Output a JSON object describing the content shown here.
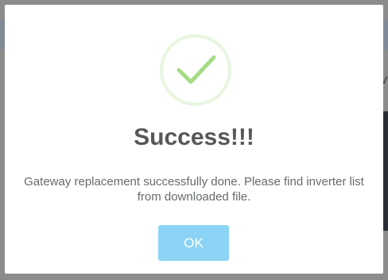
{
  "dialog": {
    "title": "Success!!!",
    "message": "Gateway replacement successfully done. Please find inverter list from downloaded file.",
    "ok_label": "OK",
    "icon": "check-icon",
    "colors": {
      "check": "#a5dc86",
      "button": "#8cd4f5",
      "title": "#575757",
      "message": "#666a6d"
    }
  }
}
